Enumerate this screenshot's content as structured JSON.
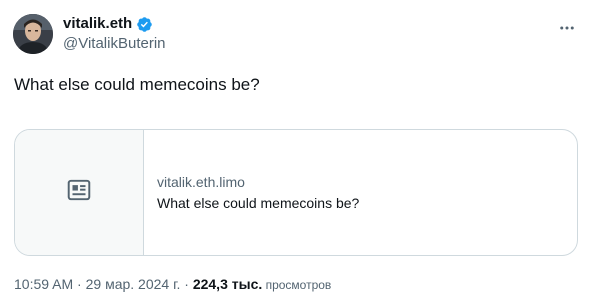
{
  "tweet": {
    "author": {
      "display_name": "vitalik.eth",
      "handle": "@VitalikButerin",
      "verified_icon": "verified-badge-icon",
      "avatar": "avatar"
    },
    "text": "What else could memecoins be?",
    "card": {
      "thumbnail_icon": "article-icon",
      "domain": "vitalik.eth.limo",
      "title": "What else could memecoins be?"
    },
    "meta": {
      "time": "10:59 AM",
      "separator1": " · ",
      "date": "29 мар. 2024 г.",
      "separator2": " · ",
      "views_count": "224,3 тыс.",
      "views_label": " просмотров"
    },
    "more_icon": "more-horizontal-icon"
  },
  "colors": {
    "verified": "#1d9bf0",
    "text_primary": "#0f1419",
    "text_secondary": "#536471",
    "border": "#cfd9de",
    "card_thumb_bg": "#f7f9f9"
  }
}
